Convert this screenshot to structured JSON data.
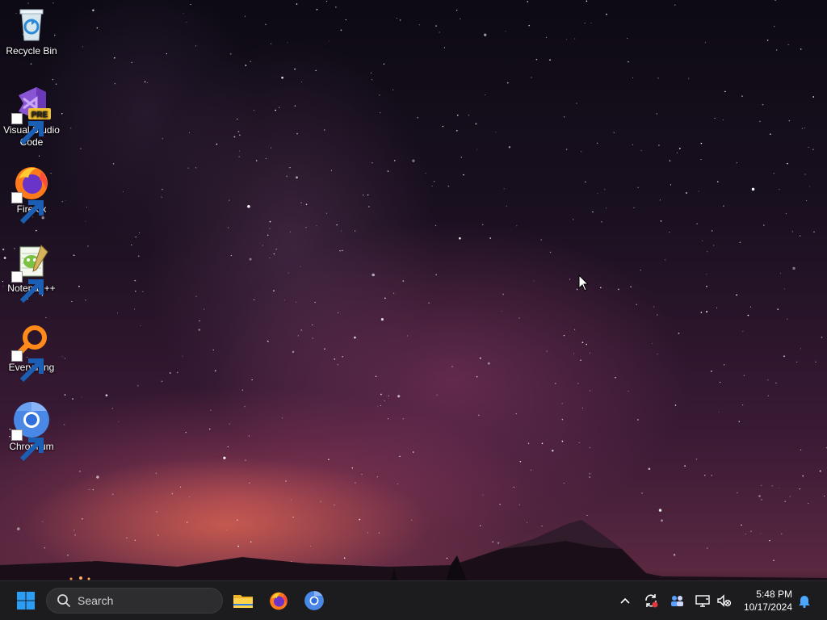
{
  "desktop": {
    "icons": [
      {
        "label": "Recycle Bin",
        "icon": "recycle-bin-icon"
      },
      {
        "label": "Visual Studio Code",
        "icon": "visual-studio-pre-icon",
        "badge": "PRE"
      },
      {
        "label": "Firefox",
        "icon": "firefox-icon"
      },
      {
        "label": "Notepad++",
        "icon": "notepad-plus-plus-icon"
      },
      {
        "label": "Everything",
        "icon": "everything-search-icon"
      },
      {
        "label": "Chromium",
        "icon": "chromium-icon"
      }
    ],
    "wallpaper": "starry-night-milky-way"
  },
  "taskbar": {
    "start_icon": "windows-start-icon",
    "search": {
      "placeholder": "Search",
      "icon": "search-icon"
    },
    "pinned": [
      {
        "name": "File Explorer",
        "icon": "folder-icon"
      },
      {
        "name": "Firefox",
        "icon": "firefox-icon"
      },
      {
        "name": "Chromium",
        "icon": "chromium-icon"
      }
    ],
    "tray": [
      {
        "name": "show-hidden-icons",
        "icon": "chevron-up-icon"
      },
      {
        "name": "sync",
        "icon": "sync-icon"
      },
      {
        "name": "people",
        "icon": "people-icon"
      },
      {
        "name": "network",
        "icon": "network-icon"
      },
      {
        "name": "volume",
        "icon": "volume-muted-icon"
      }
    ],
    "clock": {
      "time": "5:48 PM",
      "date": "10/17/2024"
    },
    "notifications_icon": "bell-icon"
  },
  "colors": {
    "taskbar_bg": "#1c1c1f",
    "windows_blue": "#2b9df4",
    "vs_purple": "#8a55d4",
    "firefox_orange": "#ff7a1a",
    "chromium_blue": "#4a88e8"
  }
}
